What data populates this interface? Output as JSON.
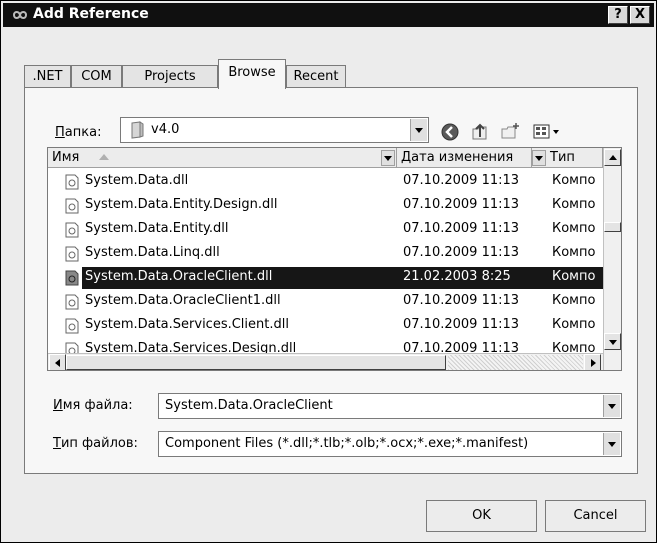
{
  "window": {
    "title": "Add Reference",
    "help_label": "?",
    "close_label": "X"
  },
  "tabs": [
    {
      "label": ".NET",
      "active": false
    },
    {
      "label": "COM",
      "active": false
    },
    {
      "label": "Projects",
      "active": false
    },
    {
      "label": "Browse",
      "active": true
    },
    {
      "label": "Recent",
      "active": false
    }
  ],
  "folder": {
    "label_hotkey": "П",
    "label_rest": "апка:",
    "value": "v4.0"
  },
  "toolbar": {
    "icons": [
      "back-icon",
      "up-folder-icon",
      "new-folder-icon",
      "view-menu-icon"
    ]
  },
  "list": {
    "columns": [
      {
        "label": "Имя"
      },
      {
        "label": "Дата изменения"
      },
      {
        "label": "Тип"
      }
    ],
    "rows": [
      {
        "name": "System.Data.dll",
        "date": "07.10.2009 11:13",
        "type": "Компо",
        "selected": false
      },
      {
        "name": "System.Data.Entity.Design.dll",
        "date": "07.10.2009 11:13",
        "type": "Компо",
        "selected": false
      },
      {
        "name": "System.Data.Entity.dll",
        "date": "07.10.2009 11:13",
        "type": "Компо",
        "selected": false
      },
      {
        "name": "System.Data.Linq.dll",
        "date": "07.10.2009 11:13",
        "type": "Компо",
        "selected": false
      },
      {
        "name": "System.Data.OracleClient.dll",
        "date": "21.02.2003 8:25",
        "type": "Компо",
        "selected": true
      },
      {
        "name": "System.Data.OracleClient1.dll",
        "date": "07.10.2009 11:13",
        "type": "Компо",
        "selected": false
      },
      {
        "name": "System.Data.Services.Client.dll",
        "date": "07.10.2009 11:13",
        "type": "Компо",
        "selected": false
      },
      {
        "name": "System.Data.Services.Design.dll",
        "date": "07.10.2009 11:13",
        "type": "Компо",
        "selected": false
      }
    ]
  },
  "filename": {
    "label_hotkey": "И",
    "label_rest": "мя файла:",
    "value": "System.Data.OracleClient"
  },
  "filetype": {
    "label_hotkey": "Т",
    "label_rest": "ип файлов:",
    "value": "Component Files (*.dll;*.tlb;*.olb;*.ocx;*.exe;*.manifest)"
  },
  "buttons": {
    "ok": "OK",
    "cancel": "Cancel"
  },
  "colors": {
    "titlebar": "#101010",
    "selection": "#161616",
    "dialog_bg": "#ececec"
  }
}
